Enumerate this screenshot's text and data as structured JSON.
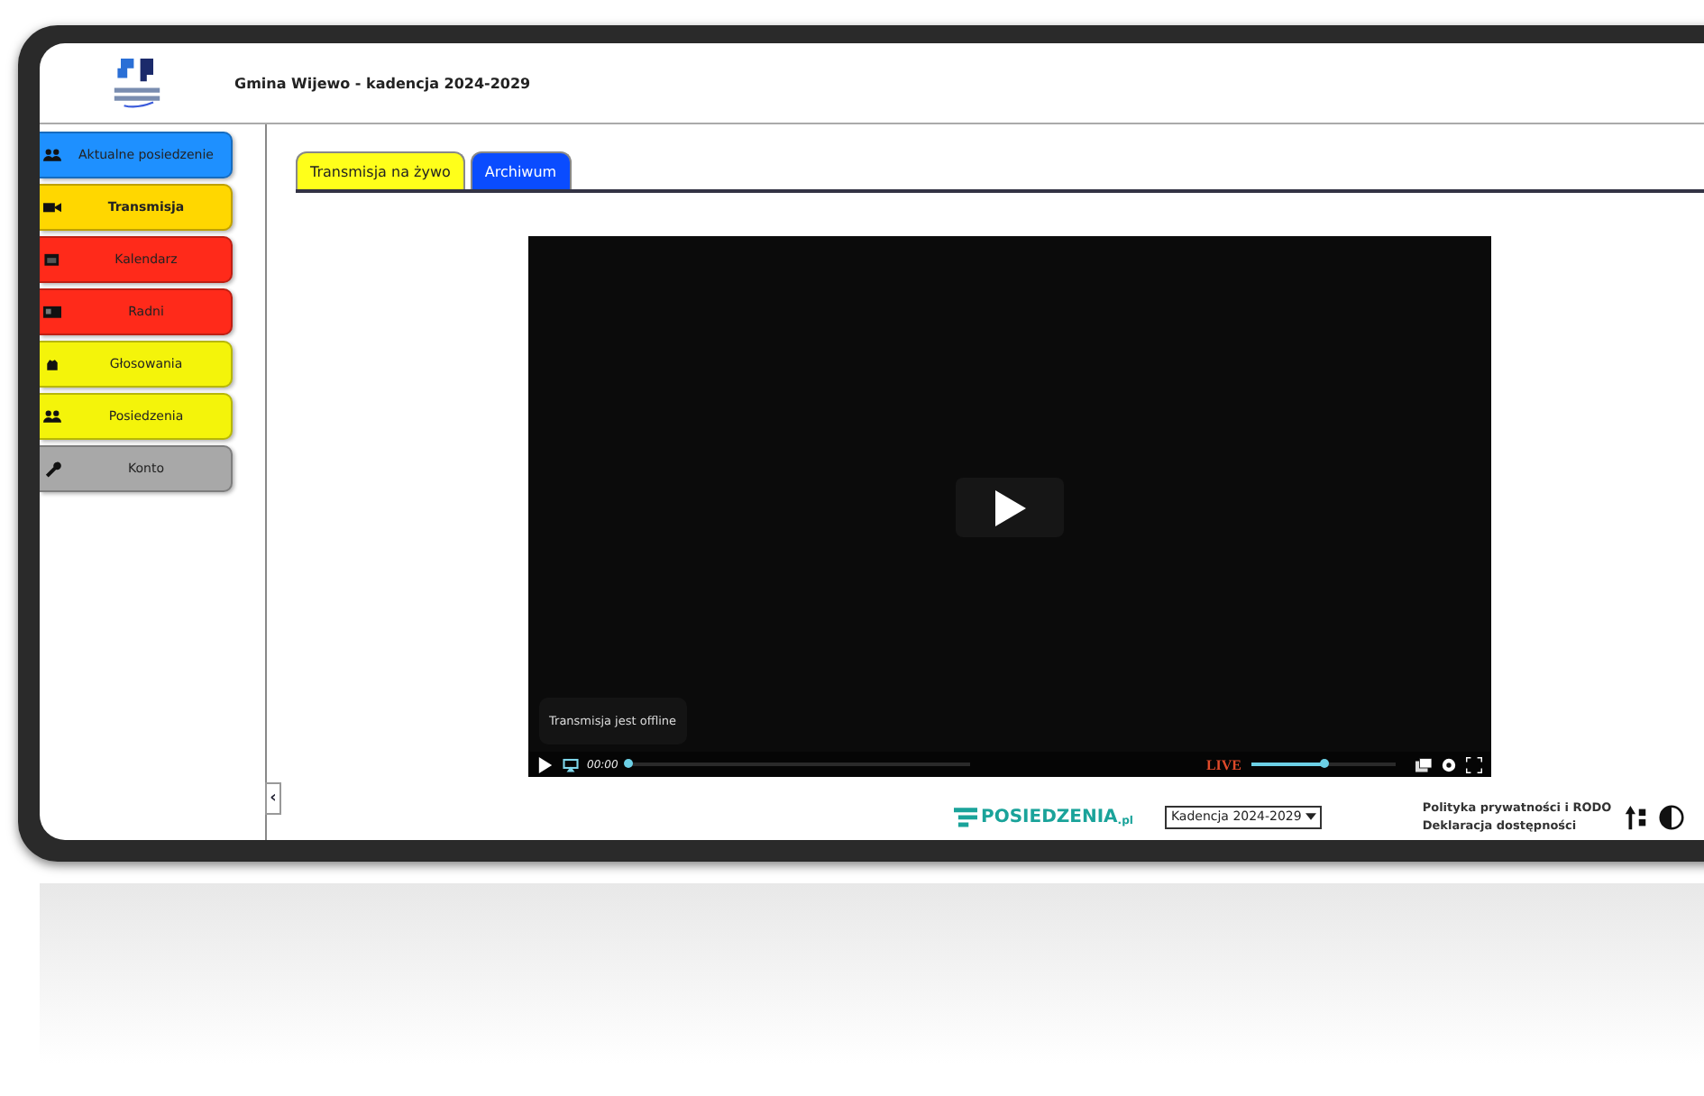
{
  "header": {
    "title": "Gmina Wijewo - kadencja 2024-2029"
  },
  "sidebar": {
    "items": [
      {
        "label": "Aktualne posiedzenie",
        "color": "#1e90ff",
        "selected": false
      },
      {
        "label": "Transmisja",
        "color": "#ffd700",
        "selected": true
      },
      {
        "label": "Kalendarz",
        "color": "#ff2a1a",
        "selected": false
      },
      {
        "label": "Radni",
        "color": "#ff2a1a",
        "selected": false
      },
      {
        "label": "Głosowania",
        "color": "#f4f40a",
        "selected": false
      },
      {
        "label": "Posiedzenia",
        "color": "#f4f40a",
        "selected": false
      },
      {
        "label": "Konto",
        "color": "#a8a8a8",
        "selected": false
      }
    ],
    "collapse": "‹"
  },
  "tabs": [
    {
      "label": "Transmisja na żywo",
      "color": "#ffff1a",
      "selected": true
    },
    {
      "label": "Archiwum",
      "color": "#0a4cff",
      "selected": false
    }
  ],
  "player": {
    "message": "Transmisja jest offline",
    "time": "00:00",
    "live": "LIVE",
    "progress": {
      "level": 0.0
    },
    "volume": {
      "level": 0.5
    }
  },
  "footer": {
    "brand": "POSIEDZENIA",
    "brand_suffix": ".pl",
    "term_select": "Kadencja 2024-2029",
    "links": [
      "Polityka prywatności i RODO",
      "Deklaracja dostępności"
    ]
  }
}
